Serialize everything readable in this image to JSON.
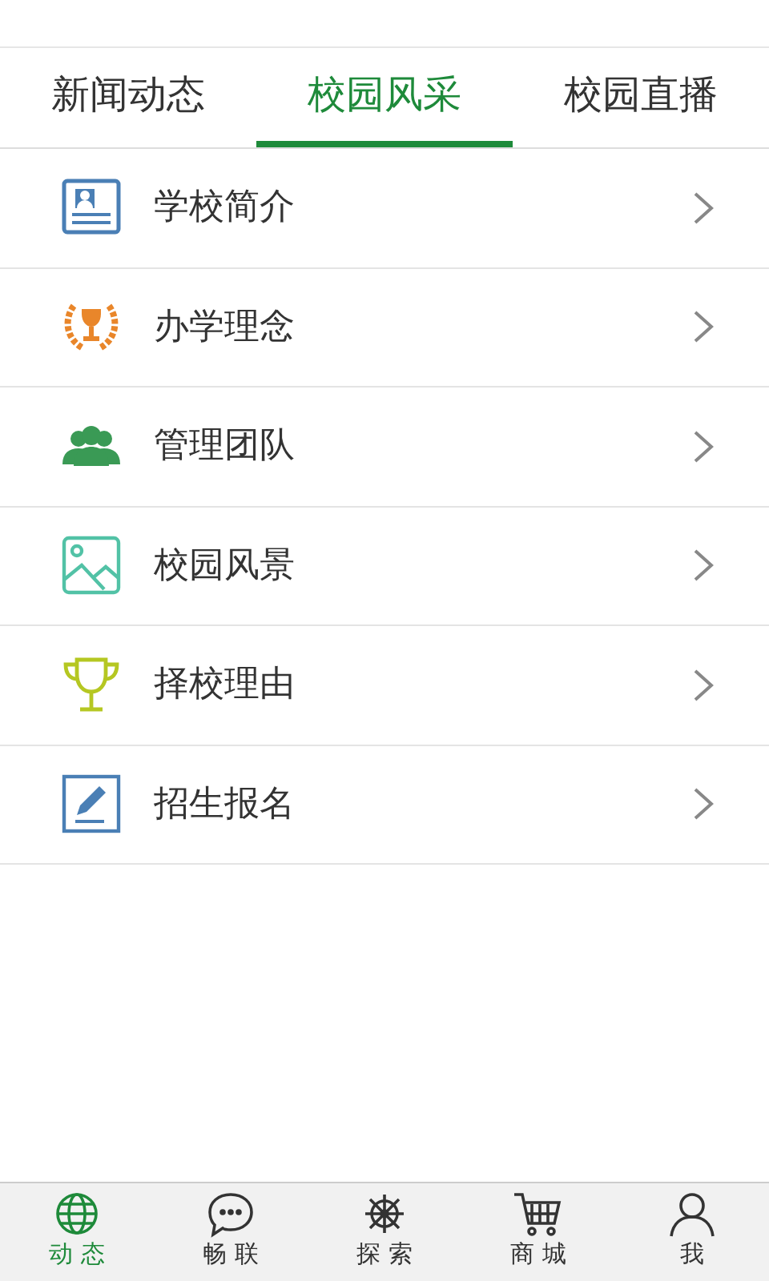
{
  "tabs": [
    {
      "label": "新闻动态",
      "selected": false
    },
    {
      "label": "校园风采",
      "selected": true
    },
    {
      "label": "校园直播",
      "selected": false
    }
  ],
  "menu": [
    {
      "label": "学校简介"
    },
    {
      "label": "办学理念"
    },
    {
      "label": "管理团队"
    },
    {
      "label": "校园风景"
    },
    {
      "label": "择校理由"
    },
    {
      "label": "招生报名"
    }
  ],
  "bottom_nav": [
    {
      "label": "动 态",
      "selected": true
    },
    {
      "label": "畅 联",
      "selected": false
    },
    {
      "label": "探 索",
      "selected": false
    },
    {
      "label": "商 城",
      "selected": false
    },
    {
      "label": "我",
      "selected": false
    }
  ]
}
